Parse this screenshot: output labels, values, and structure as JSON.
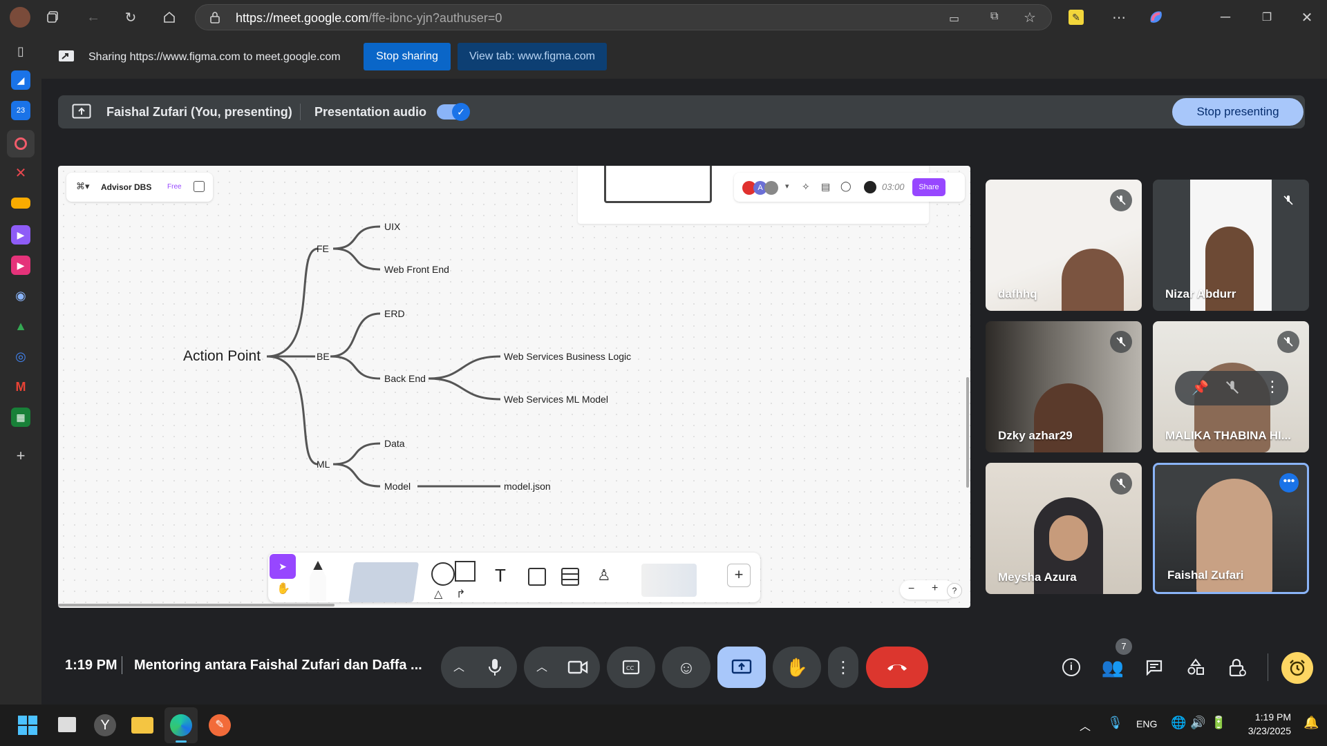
{
  "browser": {
    "url_host": "https://meet.google.com",
    "url_path": "/ffe-ibnc-yjn?authuser=0"
  },
  "sharebar": {
    "message": "Sharing https://www.figma.com to meet.google.com",
    "stop_sharing": "Stop sharing",
    "view_tab": "View tab: www.figma.com"
  },
  "presenting": {
    "presenter": "Faishal Zufari (You, presenting)",
    "audio_label": "Presentation audio",
    "audio_on": true,
    "stop_presenting": "Stop presenting"
  },
  "figma": {
    "file_name": "Advisor DBS",
    "plan_badge": "Free",
    "timer": "03:00",
    "share_label": "Share",
    "avatar_letter": "A",
    "mindmap": {
      "root": "Action Point",
      "fe": "FE",
      "fe_uix": "UIX",
      "fe_web": "Web Front End",
      "be": "BE",
      "be_erd": "ERD",
      "be_backend": "Back End",
      "be_logic": "Web Services Business Logic",
      "be_ml": "Web Services ML Model",
      "ml": "ML",
      "ml_data": "Data",
      "ml_model": "Model",
      "ml_json": "model.json"
    },
    "zoom_minus": "−",
    "zoom_plus": "+",
    "help": "?"
  },
  "participants": [
    {
      "name": "dafhhq",
      "muted": true
    },
    {
      "name": "Nizar Abdurr",
      "muted": true
    },
    {
      "name": "Dzky azhar29",
      "muted": true
    },
    {
      "name": "MALIKA THABINA HI...",
      "muted": true
    },
    {
      "name": "Meysha Azura",
      "muted": true
    },
    {
      "name": "Faishal Zufari",
      "muted": false
    }
  ],
  "bottom": {
    "time": "1:19 PM",
    "meeting_title": "Mentoring antara Faishal Zufari dan Daffa ...",
    "people_count": "7"
  },
  "taskbar": {
    "language": "ENG",
    "clock_time": "1:19 PM",
    "clock_date": "3/23/2025"
  },
  "colors": {
    "accent_blue": "#8ab4f8",
    "end_call_red": "#ea4335",
    "figma_purple": "#9747ff",
    "timer_yellow": "#fdd663"
  }
}
